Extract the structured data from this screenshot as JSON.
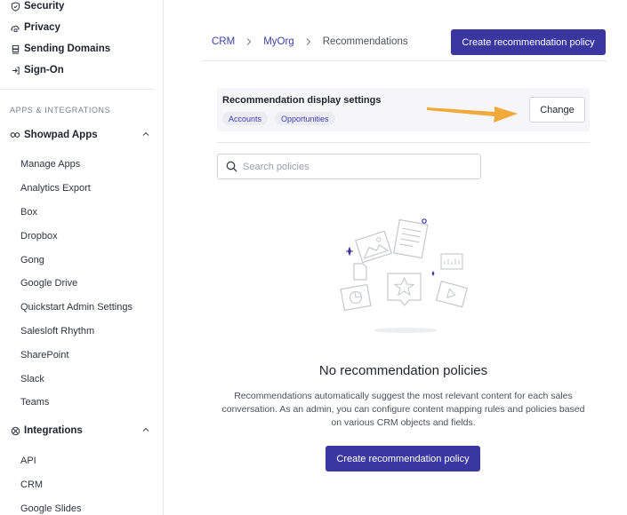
{
  "sidebar": {
    "top_items": [
      {
        "label": "Security",
        "icon": "shield-icon"
      },
      {
        "label": "Privacy",
        "icon": "cloud-lock-icon"
      },
      {
        "label": "Sending Domains",
        "icon": "server-icon"
      },
      {
        "label": "Sign-On",
        "icon": "sign-on-icon"
      }
    ],
    "section_label": "APPS & INTEGRATIONS",
    "groups": [
      {
        "label": "Showpad Apps",
        "icon": "link-icon",
        "items": [
          "Manage Apps",
          "Analytics Export",
          "Box",
          "Dropbox",
          "Gong",
          "Google Drive",
          "Quickstart Admin Settings",
          "Salesloft Rhythm",
          "SharePoint",
          "Slack",
          "Teams"
        ]
      },
      {
        "label": "Integrations",
        "icon": "integrations-icon",
        "items": [
          "API",
          "CRM",
          "Google Slides"
        ]
      }
    ]
  },
  "breadcrumb": {
    "items": [
      "CRM",
      "MyOrg"
    ],
    "current": "Recommendations"
  },
  "header": {
    "create_button": "Create recommendation policy"
  },
  "settings_panel": {
    "title": "Recommendation display settings",
    "tags": [
      "Accounts",
      "Opportunities"
    ],
    "change_button": "Change"
  },
  "search": {
    "placeholder": "Search policies",
    "value": ""
  },
  "empty_state": {
    "title": "No recommendation policies",
    "description": "Recommendations automatically suggest the most relevant content for each sales conversation. As an admin, you can configure content mapping rules and policies based on various CRM objects and fields.",
    "create_button": "Create recommendation policy"
  },
  "colors": {
    "accent": "#3a37a0",
    "link": "#3c3fa8",
    "annotation_arrow": "#f2a93b"
  }
}
